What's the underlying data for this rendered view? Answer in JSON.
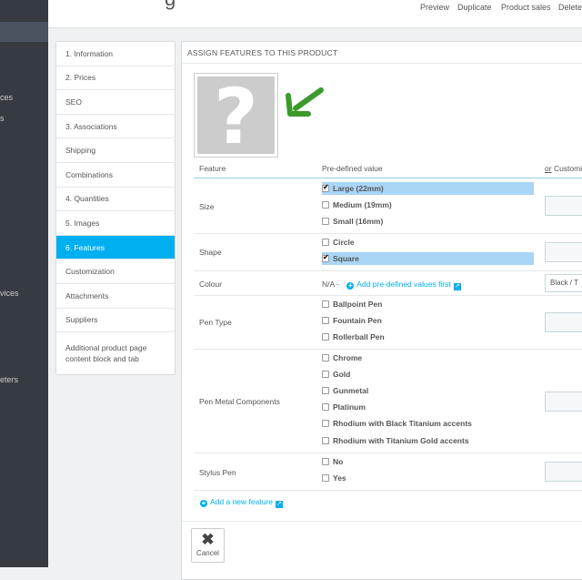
{
  "sidebar": {
    "items": [
      "ces",
      "s",
      "vices",
      "eters"
    ]
  },
  "header": {
    "title_fragment": "g"
  },
  "toolbar": {
    "preview": "Preview",
    "duplicate": "Duplicate",
    "product_sales": "Product sales",
    "delete": "Delete"
  },
  "tabs": [
    "1. Information",
    "2. Prices",
    "SEO",
    "3. Associations",
    "Shipping",
    "Combinations",
    "4. Quantities",
    "5. Images",
    "6. Features",
    "Customization",
    "Attachments",
    "Suppliers",
    "Additional product page content block and tab"
  ],
  "active_tab": "6. Features",
  "panel": {
    "heading": "ASSIGN FEATURES TO THIS PRODUCT",
    "placeholder_icon": "question-mark-icon",
    "col_feature": "Feature",
    "col_predefined": "Pre-defined value",
    "col_custom_or": "or",
    "col_custom": "Customi"
  },
  "features": [
    {
      "name": "Size",
      "options": [
        {
          "label": "Large (22mm)",
          "checked": true
        },
        {
          "label": "Medium (19mm)",
          "checked": false
        },
        {
          "label": "Small (16mm)",
          "checked": false
        }
      ]
    },
    {
      "name": "Shape",
      "options": [
        {
          "label": "Circle",
          "checked": false
        },
        {
          "label": "Square",
          "checked": true
        }
      ]
    },
    {
      "name": "Colour",
      "na": "N/A -",
      "add_link": "Add pre-defined values first",
      "custom_value": "Black / T"
    },
    {
      "name": "Pen Type",
      "options": [
        {
          "label": "Ballpoint Pen",
          "checked": false
        },
        {
          "label": "Fountain Pen",
          "checked": false
        },
        {
          "label": "Rollerball Pen",
          "checked": false
        }
      ]
    },
    {
      "name": "Pen Metal Components",
      "options": [
        {
          "label": "Chrome",
          "checked": false
        },
        {
          "label": "Gold",
          "checked": false
        },
        {
          "label": "Gunmetal",
          "checked": false
        },
        {
          "label": "Platinum",
          "checked": false
        },
        {
          "label": "Rhodium with Black Titanium accents",
          "checked": false
        },
        {
          "label": "Rhodium with Titanium Gold accents",
          "checked": false
        }
      ]
    },
    {
      "name": "Stylus Pen",
      "options": [
        {
          "label": "No",
          "checked": false
        },
        {
          "label": "Yes",
          "checked": false
        }
      ]
    }
  ],
  "add_feature": "Add a new feature",
  "cancel": "Cancel",
  "colors": {
    "accent": "#00aff0",
    "selected_row": "#a9d5f6",
    "sidebar": "#363a41",
    "arrow": "#3a9a2a"
  }
}
